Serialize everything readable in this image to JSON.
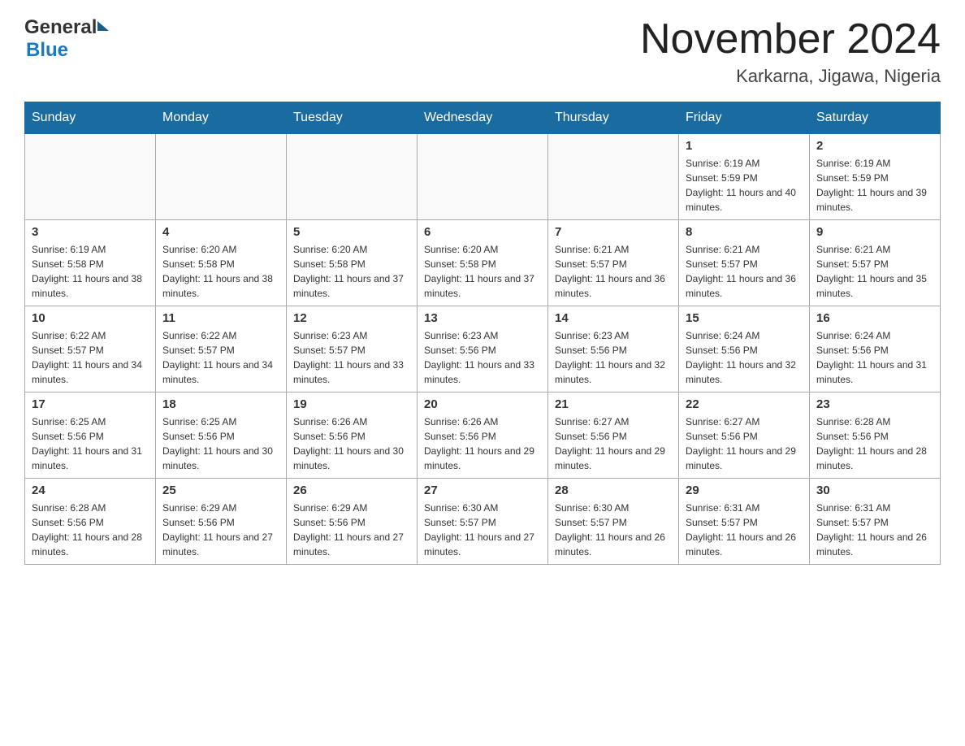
{
  "header": {
    "logo_general": "General",
    "logo_blue": "Blue",
    "main_title": "November 2024",
    "subtitle": "Karkarna, Jigawa, Nigeria"
  },
  "days_of_week": [
    "Sunday",
    "Monday",
    "Tuesday",
    "Wednesday",
    "Thursday",
    "Friday",
    "Saturday"
  ],
  "weeks": [
    [
      {
        "day": "",
        "info": ""
      },
      {
        "day": "",
        "info": ""
      },
      {
        "day": "",
        "info": ""
      },
      {
        "day": "",
        "info": ""
      },
      {
        "day": "",
        "info": ""
      },
      {
        "day": "1",
        "info": "Sunrise: 6:19 AM\nSunset: 5:59 PM\nDaylight: 11 hours and 40 minutes."
      },
      {
        "day": "2",
        "info": "Sunrise: 6:19 AM\nSunset: 5:59 PM\nDaylight: 11 hours and 39 minutes."
      }
    ],
    [
      {
        "day": "3",
        "info": "Sunrise: 6:19 AM\nSunset: 5:58 PM\nDaylight: 11 hours and 38 minutes."
      },
      {
        "day": "4",
        "info": "Sunrise: 6:20 AM\nSunset: 5:58 PM\nDaylight: 11 hours and 38 minutes."
      },
      {
        "day": "5",
        "info": "Sunrise: 6:20 AM\nSunset: 5:58 PM\nDaylight: 11 hours and 37 minutes."
      },
      {
        "day": "6",
        "info": "Sunrise: 6:20 AM\nSunset: 5:58 PM\nDaylight: 11 hours and 37 minutes."
      },
      {
        "day": "7",
        "info": "Sunrise: 6:21 AM\nSunset: 5:57 PM\nDaylight: 11 hours and 36 minutes."
      },
      {
        "day": "8",
        "info": "Sunrise: 6:21 AM\nSunset: 5:57 PM\nDaylight: 11 hours and 36 minutes."
      },
      {
        "day": "9",
        "info": "Sunrise: 6:21 AM\nSunset: 5:57 PM\nDaylight: 11 hours and 35 minutes."
      }
    ],
    [
      {
        "day": "10",
        "info": "Sunrise: 6:22 AM\nSunset: 5:57 PM\nDaylight: 11 hours and 34 minutes."
      },
      {
        "day": "11",
        "info": "Sunrise: 6:22 AM\nSunset: 5:57 PM\nDaylight: 11 hours and 34 minutes."
      },
      {
        "day": "12",
        "info": "Sunrise: 6:23 AM\nSunset: 5:57 PM\nDaylight: 11 hours and 33 minutes."
      },
      {
        "day": "13",
        "info": "Sunrise: 6:23 AM\nSunset: 5:56 PM\nDaylight: 11 hours and 33 minutes."
      },
      {
        "day": "14",
        "info": "Sunrise: 6:23 AM\nSunset: 5:56 PM\nDaylight: 11 hours and 32 minutes."
      },
      {
        "day": "15",
        "info": "Sunrise: 6:24 AM\nSunset: 5:56 PM\nDaylight: 11 hours and 32 minutes."
      },
      {
        "day": "16",
        "info": "Sunrise: 6:24 AM\nSunset: 5:56 PM\nDaylight: 11 hours and 31 minutes."
      }
    ],
    [
      {
        "day": "17",
        "info": "Sunrise: 6:25 AM\nSunset: 5:56 PM\nDaylight: 11 hours and 31 minutes."
      },
      {
        "day": "18",
        "info": "Sunrise: 6:25 AM\nSunset: 5:56 PM\nDaylight: 11 hours and 30 minutes."
      },
      {
        "day": "19",
        "info": "Sunrise: 6:26 AM\nSunset: 5:56 PM\nDaylight: 11 hours and 30 minutes."
      },
      {
        "day": "20",
        "info": "Sunrise: 6:26 AM\nSunset: 5:56 PM\nDaylight: 11 hours and 29 minutes."
      },
      {
        "day": "21",
        "info": "Sunrise: 6:27 AM\nSunset: 5:56 PM\nDaylight: 11 hours and 29 minutes."
      },
      {
        "day": "22",
        "info": "Sunrise: 6:27 AM\nSunset: 5:56 PM\nDaylight: 11 hours and 29 minutes."
      },
      {
        "day": "23",
        "info": "Sunrise: 6:28 AM\nSunset: 5:56 PM\nDaylight: 11 hours and 28 minutes."
      }
    ],
    [
      {
        "day": "24",
        "info": "Sunrise: 6:28 AM\nSunset: 5:56 PM\nDaylight: 11 hours and 28 minutes."
      },
      {
        "day": "25",
        "info": "Sunrise: 6:29 AM\nSunset: 5:56 PM\nDaylight: 11 hours and 27 minutes."
      },
      {
        "day": "26",
        "info": "Sunrise: 6:29 AM\nSunset: 5:56 PM\nDaylight: 11 hours and 27 minutes."
      },
      {
        "day": "27",
        "info": "Sunrise: 6:30 AM\nSunset: 5:57 PM\nDaylight: 11 hours and 27 minutes."
      },
      {
        "day": "28",
        "info": "Sunrise: 6:30 AM\nSunset: 5:57 PM\nDaylight: 11 hours and 26 minutes."
      },
      {
        "day": "29",
        "info": "Sunrise: 6:31 AM\nSunset: 5:57 PM\nDaylight: 11 hours and 26 minutes."
      },
      {
        "day": "30",
        "info": "Sunrise: 6:31 AM\nSunset: 5:57 PM\nDaylight: 11 hours and 26 minutes."
      }
    ]
  ]
}
